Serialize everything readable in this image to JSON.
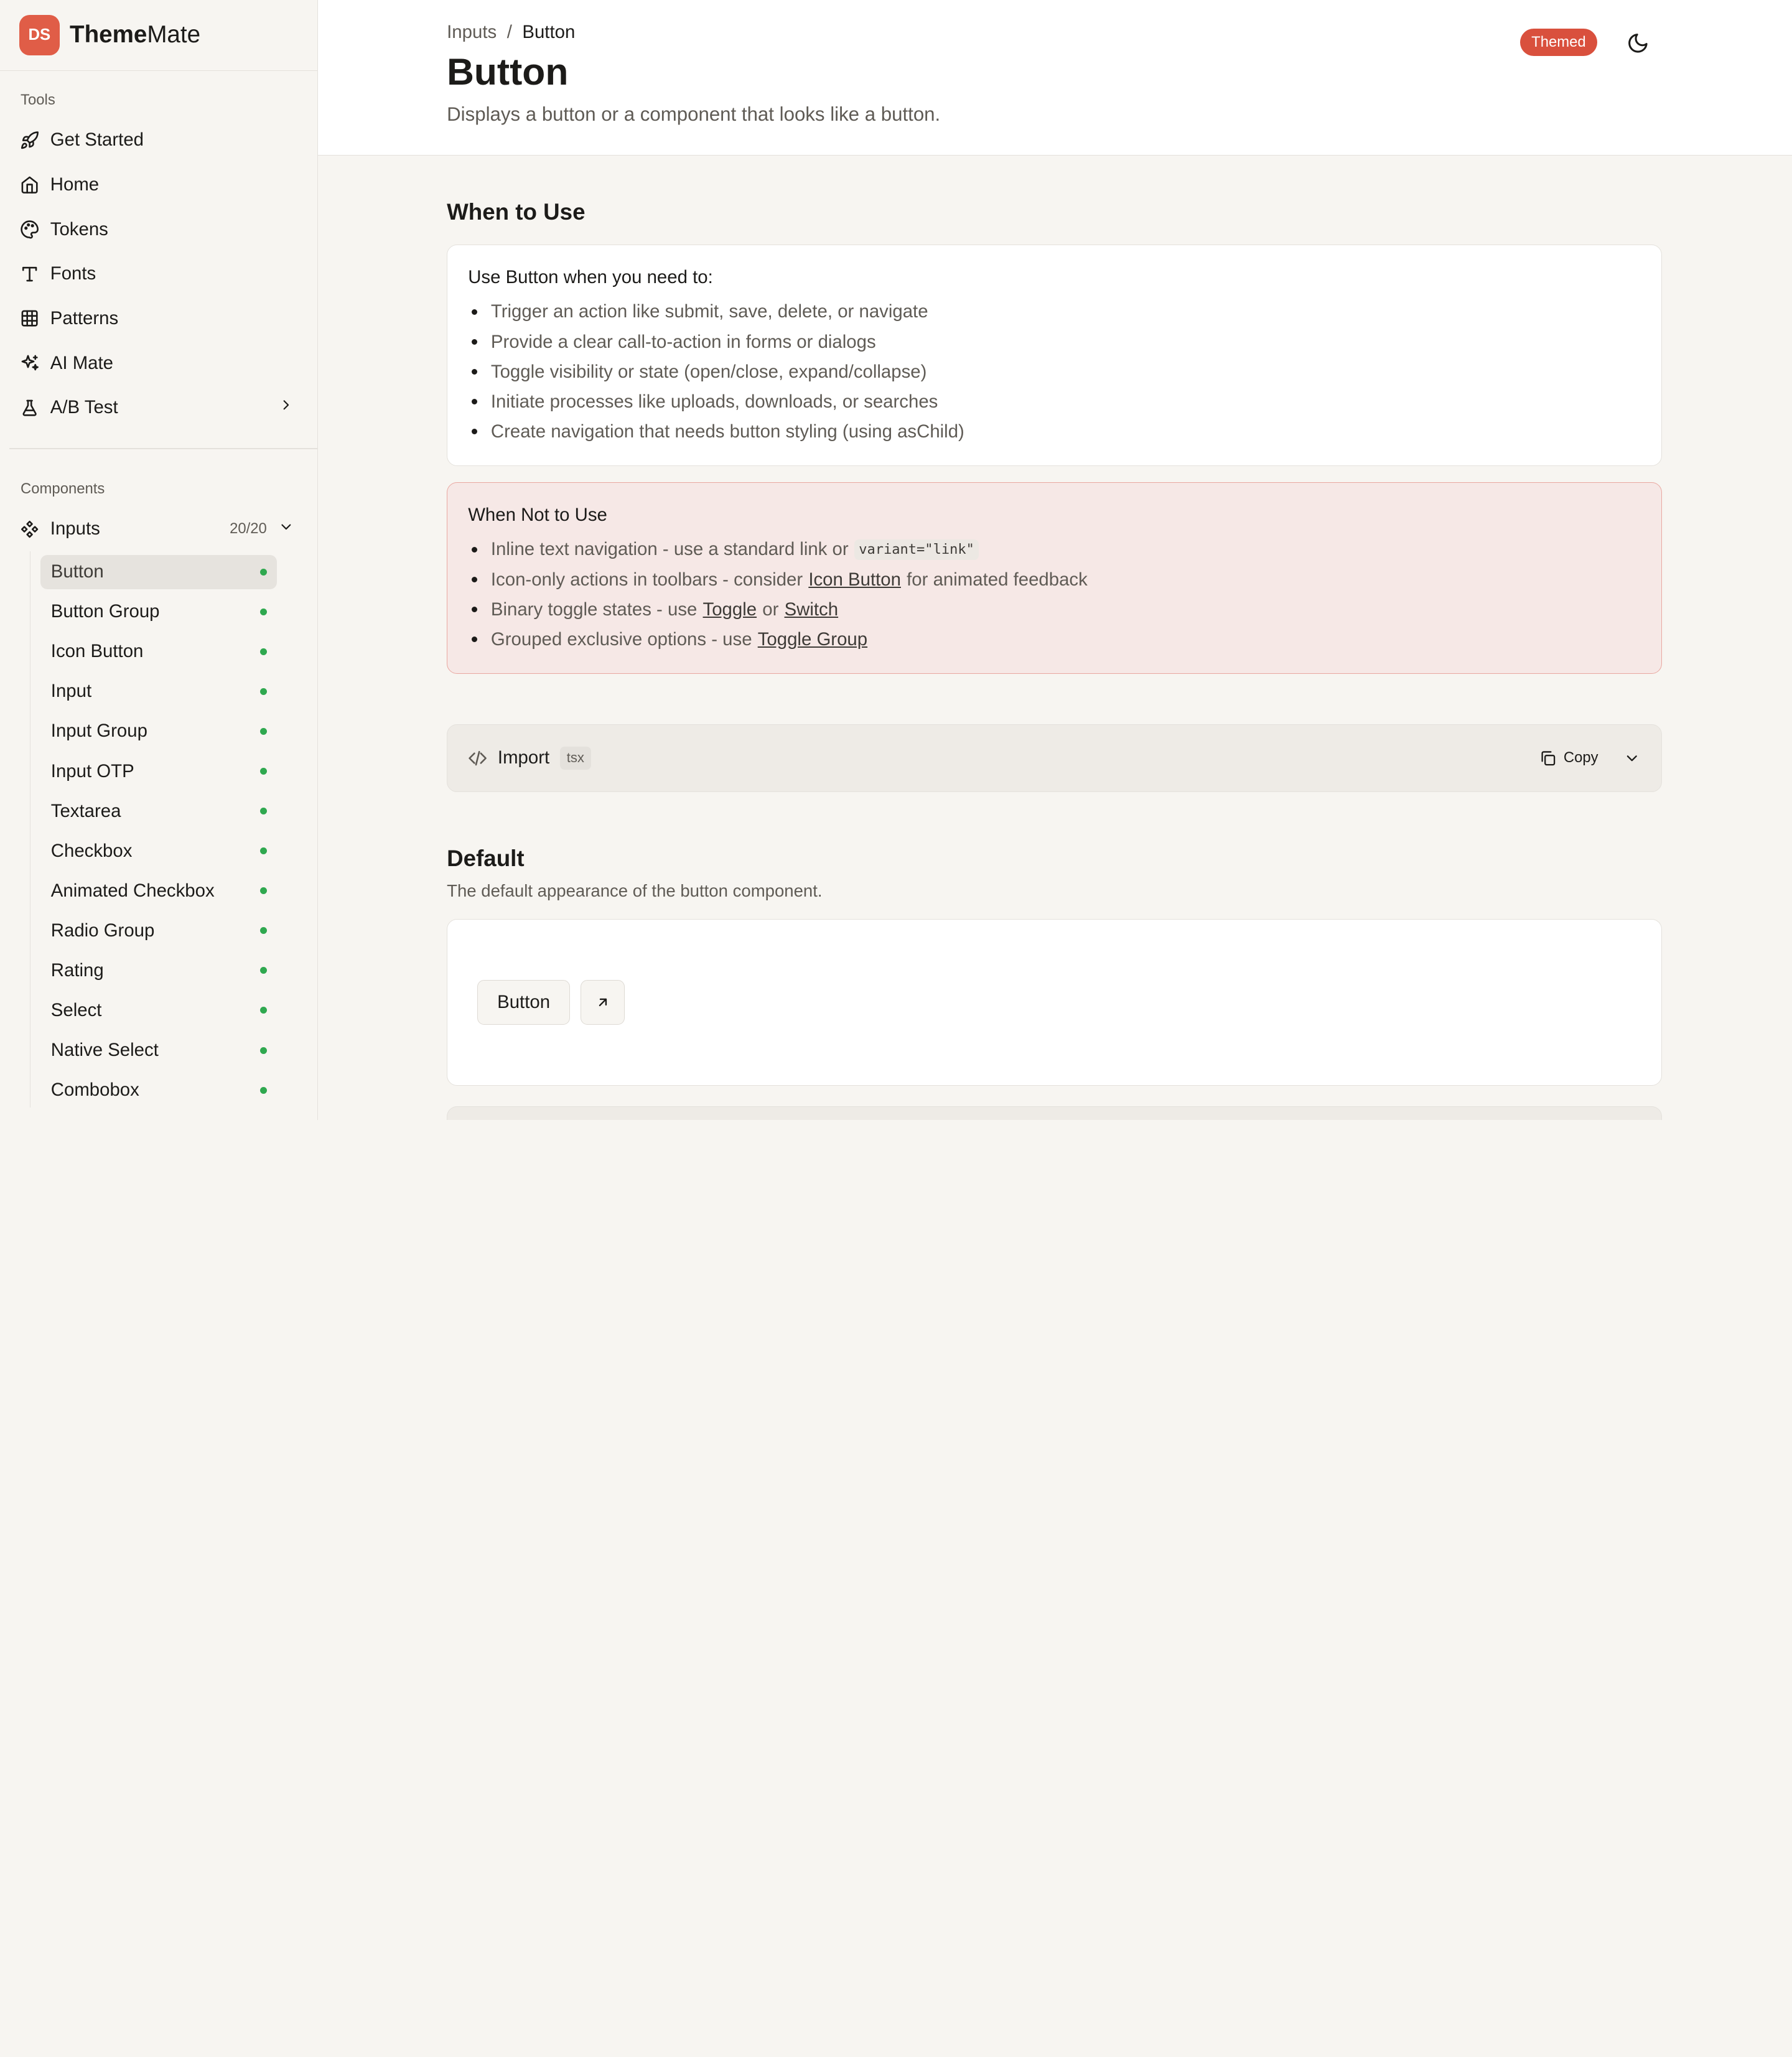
{
  "brand": {
    "logo_text": "DS",
    "name_bold": "Theme",
    "name_rest": "Mate",
    "logo_color": "#e05d47"
  },
  "sidebar": {
    "tools_label": "Tools",
    "tools": [
      {
        "label": "Get Started",
        "icon": "rocket-icon"
      },
      {
        "label": "Home",
        "icon": "home-icon"
      },
      {
        "label": "Tokens",
        "icon": "palette-icon"
      },
      {
        "label": "Fonts",
        "icon": "type-icon"
      },
      {
        "label": "Patterns",
        "icon": "grid-icon"
      },
      {
        "label": "AI Mate",
        "icon": "sparkles-icon"
      },
      {
        "label": "A/B Test",
        "icon": "flask-icon"
      }
    ],
    "components_label": "Components",
    "group": {
      "label": "Inputs",
      "count": "20/20",
      "icon": "component-icon"
    },
    "items": [
      {
        "label": "Button",
        "active": true
      },
      {
        "label": "Button Group"
      },
      {
        "label": "Icon Button"
      },
      {
        "label": "Input"
      },
      {
        "label": "Input Group"
      },
      {
        "label": "Input OTP"
      },
      {
        "label": "Textarea"
      },
      {
        "label": "Checkbox"
      },
      {
        "label": "Animated Checkbox"
      },
      {
        "label": "Radio Group"
      },
      {
        "label": "Rating"
      },
      {
        "label": "Select"
      },
      {
        "label": "Native Select"
      },
      {
        "label": "Combobox"
      }
    ],
    "status_color": "#2fa84f"
  },
  "header": {
    "breadcrumb": {
      "parent": "Inputs",
      "separator": "/",
      "current": "Button"
    },
    "title": "Button",
    "description": "Displays a button or a component that looks like a button.",
    "badge": "Themed",
    "badge_color": "#d9503d",
    "theme_toggle_icon": "moon-icon"
  },
  "when_to_use": {
    "title": "When to Use",
    "intro": "Use Button when you need to:",
    "items": [
      "Trigger an action like submit, save, delete, or navigate",
      "Provide a clear call-to-action in forms or dialogs",
      "Toggle visibility or state (open/close, expand/collapse)",
      "Initiate processes like uploads, downloads, or searches",
      "Create navigation that needs button styling (using asChild)"
    ]
  },
  "when_not": {
    "title": "When Not to Use",
    "item1": {
      "text": "Inline text navigation - use a standard link or",
      "code": "variant=\"link\""
    },
    "item2": {
      "pre": "Icon-only actions in toolbars - consider",
      "link": "Icon Button",
      "post": "for animated feedback"
    },
    "item3": {
      "pre": "Binary toggle states - use",
      "link1": "Toggle",
      "mid": "or",
      "link2": "Switch"
    },
    "item4": {
      "pre": "Grouped exclusive options - use",
      "link": "Toggle Group"
    }
  },
  "import": {
    "label": "Import",
    "lang": "tsx",
    "copy": "Copy"
  },
  "default": {
    "title": "Default",
    "description": "The default appearance of the button component.",
    "button_label": "Button"
  }
}
